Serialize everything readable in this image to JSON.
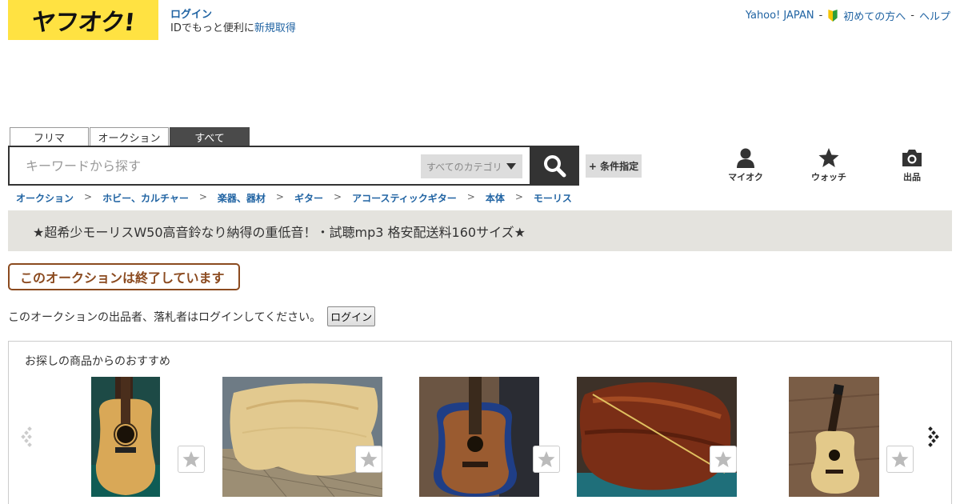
{
  "header": {
    "logo_text": "ヤフオク!",
    "login_label": "ログイン",
    "login_sub": "IDでもっと便利に",
    "register_label": "新規取得",
    "links": {
      "yahoo": "Yahoo! JAPAN",
      "beginner": "初めての方へ",
      "help": "ヘルプ"
    }
  },
  "search": {
    "tabs": [
      "フリマ",
      "オークション",
      "すべて"
    ],
    "active_tab": "すべて",
    "placeholder": "キーワードから探す",
    "category_label": "すべてのカテゴリ",
    "condition_label": "+ 条件指定"
  },
  "header_icons": [
    {
      "label": "マイオク",
      "icon": "person-icon"
    },
    {
      "label": "ウォッチ",
      "icon": "star-icon"
    },
    {
      "label": "出品",
      "icon": "camera-icon"
    }
  ],
  "breadcrumb": [
    "オークション",
    "ホビー、カルチャー",
    "楽器、器材",
    "ギター",
    "アコースティックギター",
    "本体",
    "モーリス"
  ],
  "breadcrumb_sep": ">",
  "auction_title": "★超希少モーリスW50高音鈴なり納得の重低音！・試聴mp3 格安配送料160サイズ★",
  "ended_notice": "このオークションは終了しています",
  "login_note": "このオークションの出品者、落札者はログインしてください。",
  "login_button": "ログイン",
  "recommend": {
    "title": "お探しの商品からのおすすめ",
    "items": [
      {
        "thumb": "guitar-front-dark"
      },
      {
        "thumb": "guitar-body-wood"
      },
      {
        "thumb": "guitar-in-case"
      },
      {
        "thumb": "guitar-back-rosewood"
      },
      {
        "thumb": "guitar-on-floor"
      }
    ]
  },
  "colors": {
    "brand_yellow": "#ffe242",
    "link_blue": "#2164a3",
    "ended_brown": "#8b4a1f",
    "title_bg": "#e4e3de"
  }
}
